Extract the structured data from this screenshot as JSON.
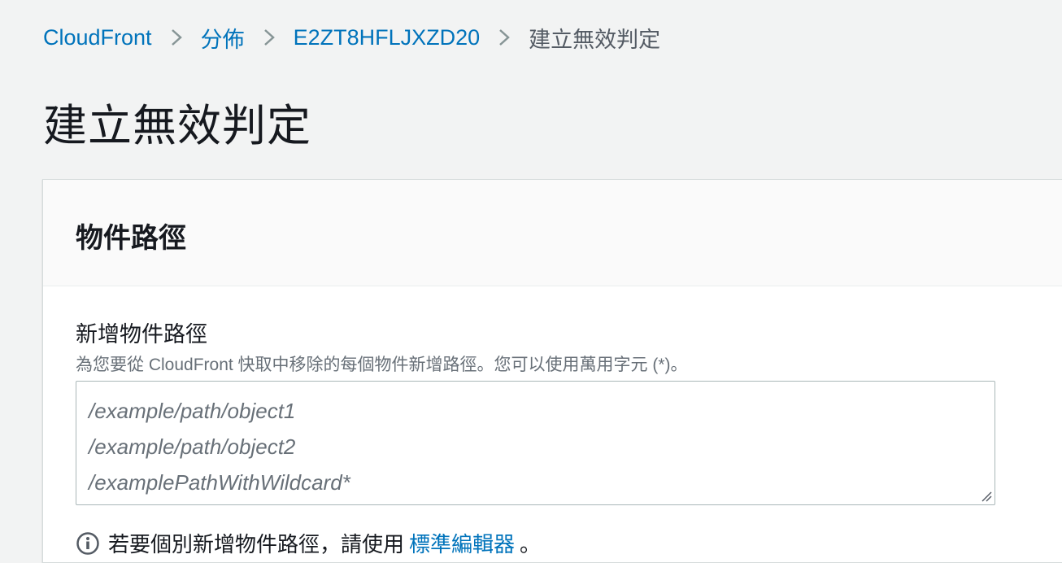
{
  "breadcrumb": {
    "items": [
      "CloudFront",
      "分佈",
      "E2ZT8HFLJXZD20"
    ],
    "current": "建立無效判定"
  },
  "page": {
    "title": "建立無效判定"
  },
  "panel": {
    "heading": "物件路徑",
    "field_label": "新增物件路徑",
    "field_description": "為您要從 CloudFront 快取中移除的每個物件新增路徑。您可以使用萬用字元 (*)。",
    "textarea_placeholder": "/example/path/object1\n/example/path/object2\n/examplePathWithWildcard*",
    "textarea_value": "",
    "info_prefix": "若要個別新增物件路徑，請使用",
    "info_link": "標準編輯器",
    "info_suffix": "。"
  },
  "colors": {
    "link": "#0073bb",
    "background": "#f2f3f3",
    "text": "#16191f",
    "muted": "#687078"
  },
  "icons": {
    "breadcrumb_separator": "chevron-right-icon",
    "info": "info-circle-icon",
    "resize": "resize-grip-icon"
  }
}
